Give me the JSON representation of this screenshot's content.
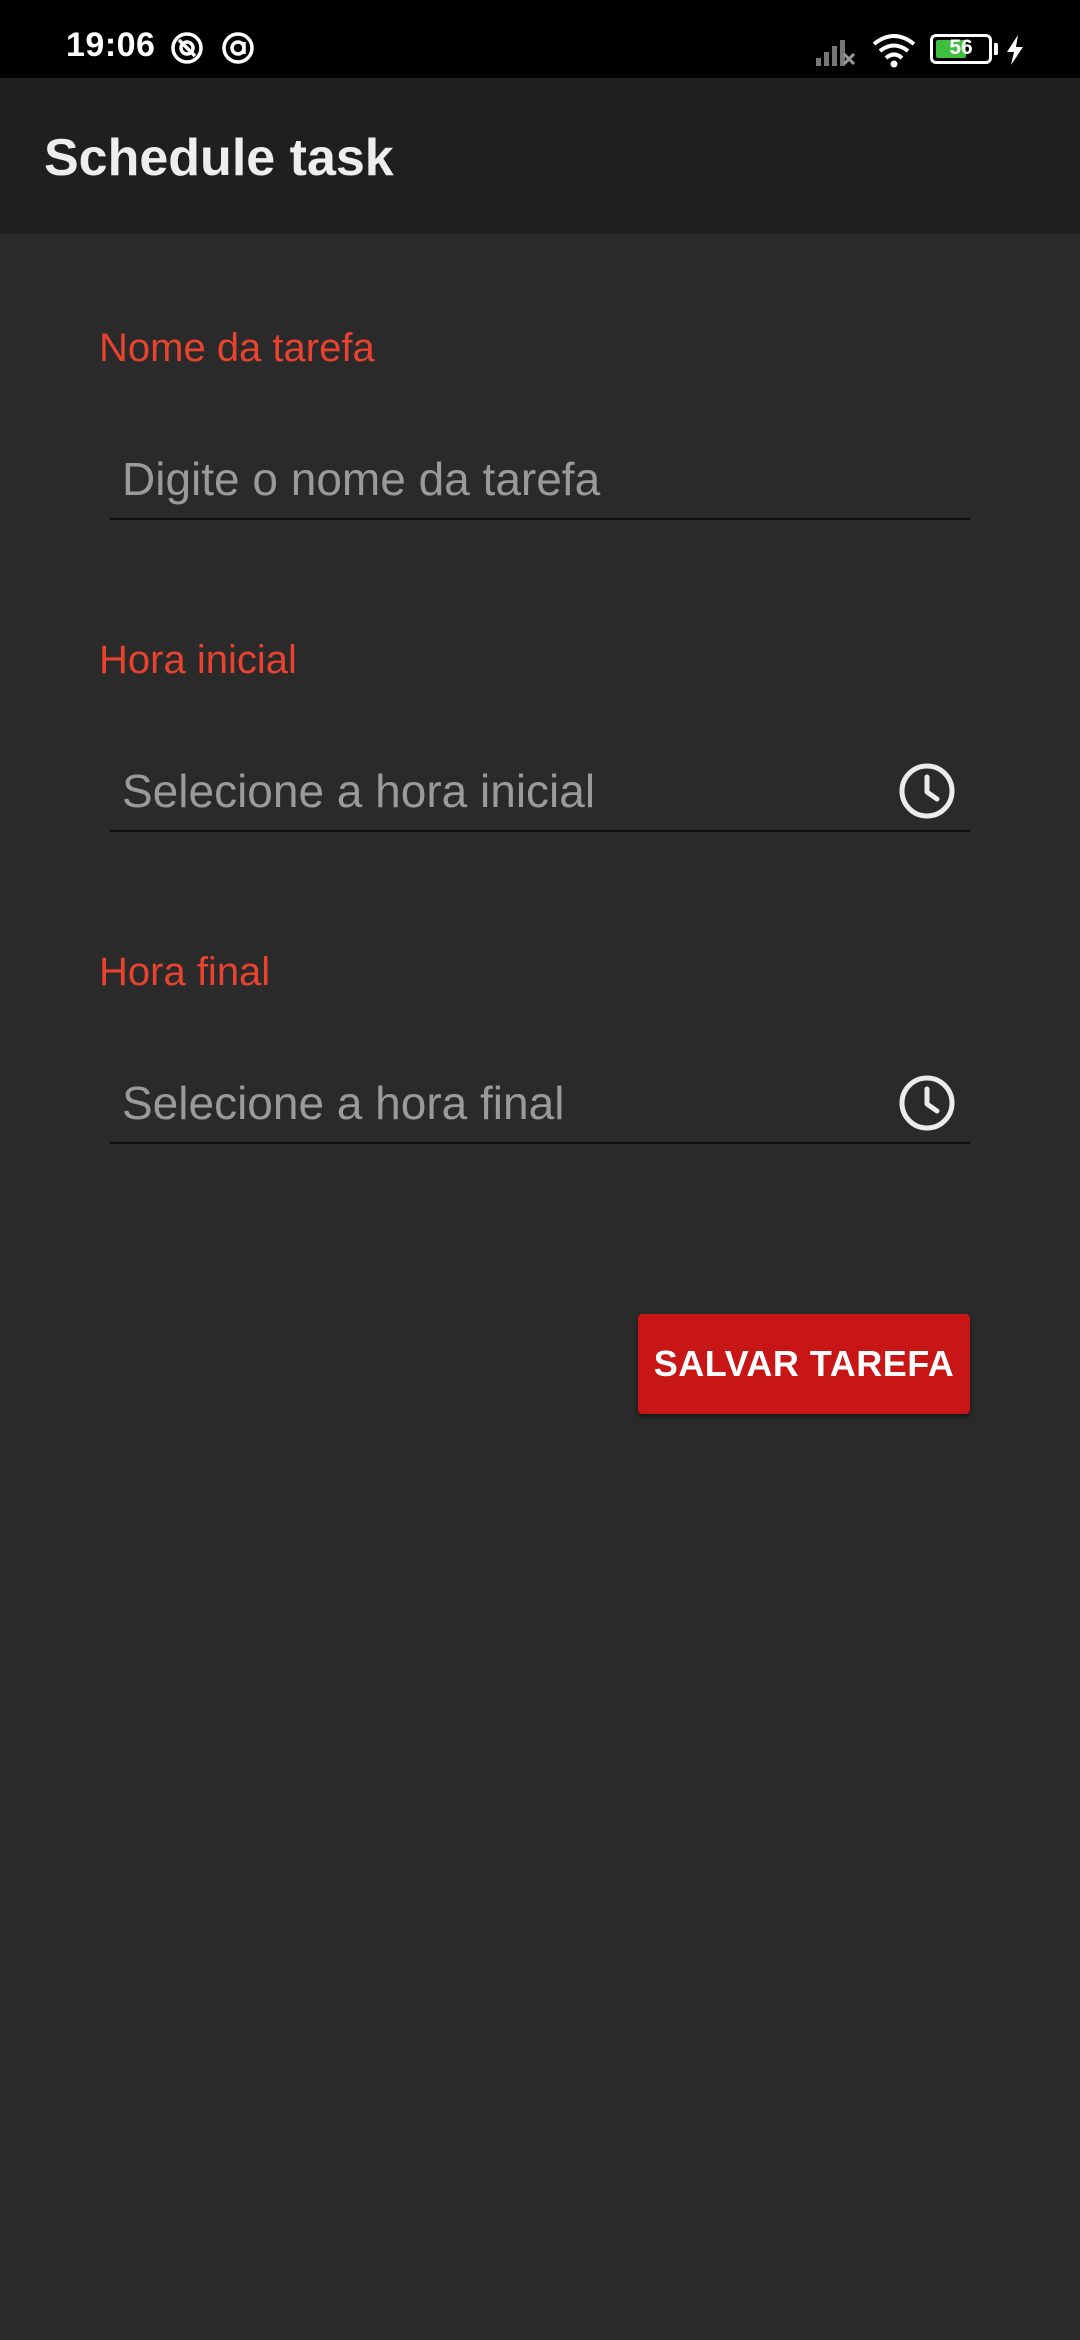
{
  "status_bar": {
    "time": "19:06",
    "battery_level": "56",
    "notification_icons": [
      "at-sign-icon",
      "at-sign-icon"
    ],
    "icons": [
      "signal-off-icon",
      "wifi-icon",
      "battery-icon",
      "charging-bolt-icon"
    ]
  },
  "app_bar": {
    "title": "Schedule task"
  },
  "form": {
    "task_name": {
      "label": "Nome da tarefa",
      "value": "",
      "placeholder": "Digite o nome da tarefa"
    },
    "start_time": {
      "label": "Hora inicial",
      "value": "",
      "placeholder": "Selecione a hora inicial",
      "icon": "clock-icon"
    },
    "end_time": {
      "label": "Hora final",
      "value": "",
      "placeholder": "Selecione a hora final",
      "icon": "clock-icon"
    },
    "save_label": "SALVAR TAREFA"
  },
  "colors": {
    "accent": "#e8432f",
    "button": "#c81515",
    "background": "#2a2a2a",
    "app_bar": "#1f1f1f"
  }
}
